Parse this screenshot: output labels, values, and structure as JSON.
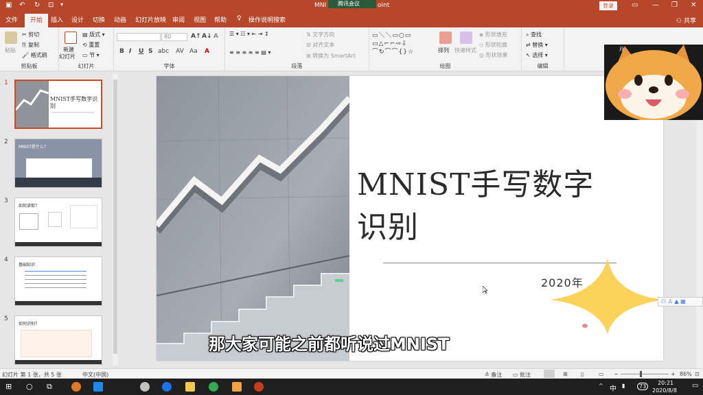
{
  "window": {
    "title": "MNIST手写数字识别 - PowerPoint",
    "title_left": "MNI",
    "title_right": "oint",
    "meeting_label": "腾讯会议",
    "login": "登录",
    "share": "共享"
  },
  "tabs": [
    "文件",
    "开始",
    "插入",
    "设计",
    "切换",
    "动画",
    "幻灯片放映",
    "审阅",
    "视图",
    "帮助"
  ],
  "active_tab": "开始",
  "tell_me": "操作说明搜索",
  "ribbon": {
    "clipboard": {
      "paste": "粘贴",
      "cut": "剪切",
      "copy": "复制",
      "format_painter": "格式刷",
      "label": "剪贴板"
    },
    "slides": {
      "new_slide_line1": "新建",
      "new_slide_line2": "幻灯片",
      "layout": "版式",
      "reset": "重置",
      "section": "节",
      "label": "幻灯片"
    },
    "font": {
      "size": "80",
      "label": "字体",
      "bold": "B",
      "italic": "I",
      "underline": "U",
      "strike": "S",
      "shadow": "abc",
      "spacing": "AV",
      "case": "Aa"
    },
    "paragraph": {
      "text_direction": "文字方向",
      "align_text": "对齐文本",
      "smartart": "转换为 SmartArt",
      "label": "段落"
    },
    "drawing": {
      "arrange": "排列",
      "quick_styles": "快速样式",
      "shape_fill": "形状填充",
      "shape_outline": "形状轮廓",
      "shape_effects": "形状效果",
      "label": "绘图"
    },
    "editing": {
      "find": "查找",
      "replace": "替换",
      "select": "选择",
      "label": "编辑"
    }
  },
  "thumbnails": [
    {
      "num": "1",
      "title": "MNIST手写数字识别",
      "selected": true
    },
    {
      "num": "2",
      "title": "MNIST是什么？",
      "selected": false
    },
    {
      "num": "3",
      "title": "如何读取？",
      "selected": false
    },
    {
      "num": "4",
      "title": "基础知识",
      "selected": false
    },
    {
      "num": "5",
      "title": "如何识别？",
      "selected": false
    }
  ],
  "slide": {
    "title_line1": "MNIST手写数字",
    "title_line2": "识别",
    "date": "2020年"
  },
  "date_tail": "月",
  "caption": "那大家可能之前都听说过MNIST",
  "statusbar": {
    "slide_info": "幻灯片 第 1 张，共 5 张",
    "language": "中文(中国)",
    "notes": "备注",
    "comments": "批注",
    "zoom": "86%"
  },
  "taskbar": {
    "ime": "中",
    "battery": "73",
    "time": "20:21",
    "date": "2020/8/8"
  },
  "colors": {
    "accent": "#b7472a",
    "thumb_border": "#d24726"
  }
}
